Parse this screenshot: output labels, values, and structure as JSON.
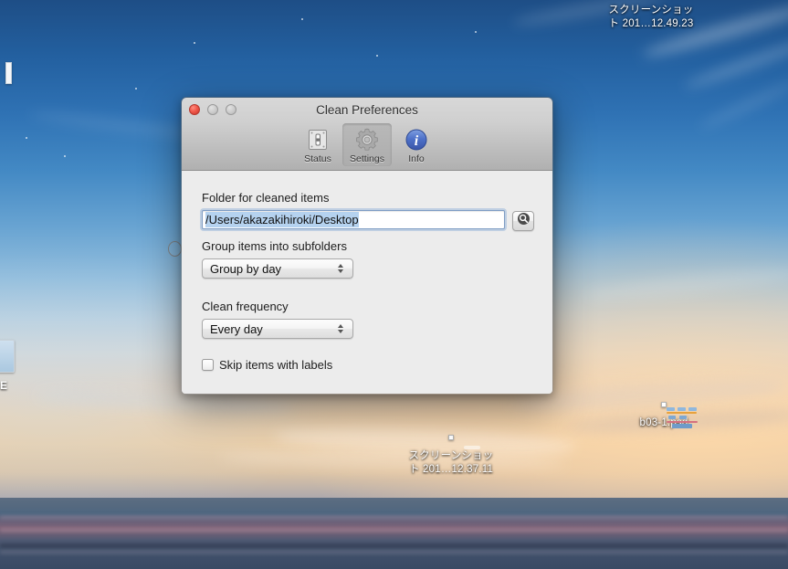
{
  "window": {
    "title": "Clean Preferences",
    "traffic_lights": {
      "close": "close-button",
      "minimize": "minimize-button",
      "zoom": "zoom-button"
    },
    "toolbar": {
      "items": [
        {
          "label": "Status",
          "icon": "status-switch-icon",
          "selected": false
        },
        {
          "label": "Settings",
          "icon": "gear-icon",
          "selected": true
        },
        {
          "label": "Info",
          "icon": "info-circle-icon",
          "selected": false
        }
      ]
    },
    "settings": {
      "folder_label": "Folder for cleaned items",
      "folder_value": "/Users/akazakihiroki/Desktop",
      "browse_icon": "magnifier-icon",
      "group_label": "Group items into subfolders",
      "group_value": "Group by day",
      "frequency_label": "Clean frequency",
      "frequency_value": "Every day",
      "skip_label": "Skip items with labels",
      "skip_checked": false
    }
  },
  "desktop": {
    "icons": [
      {
        "name": "screenshot-top-right",
        "kind": "screenshot-thumbnail",
        "line1": "スクリーンショッ",
        "line2": "ト 201…12.49.23"
      },
      {
        "name": "screenshot-bottom-center",
        "kind": "screenshot-thumbnail",
        "line1": "スクリーンショッ",
        "line2": "ト 201…12.37.11"
      },
      {
        "name": "psd-file",
        "kind": "psd-thumbnail",
        "line1": "b03-1.psd",
        "line2": ""
      }
    ],
    "edge_label": "E"
  },
  "colors": {
    "selection_blue": "#b5d2ef",
    "focus_ring": "#7ea6d4",
    "window_body": "#ececec",
    "titlebar_top": "#d8d8d8",
    "titlebar_bottom": "#b0b0b0",
    "info_blue": "#4a72c8",
    "close_red": "#f0584a"
  }
}
